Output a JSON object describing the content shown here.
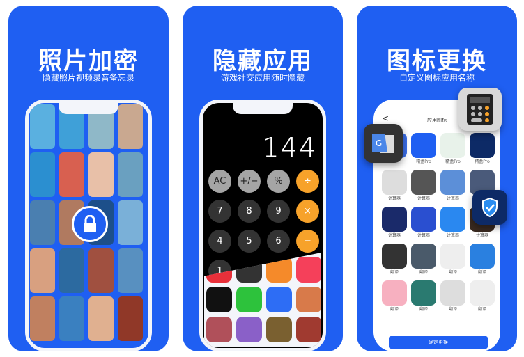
{
  "panels": [
    {
      "title": "照片加密",
      "subtitle": "隐藏照片视频录音备忘录"
    },
    {
      "title": "隐藏应用",
      "subtitle": "游戏社交应用随时隐藏"
    },
    {
      "title": "图标更换",
      "subtitle": "自定义图标应用名称"
    }
  ],
  "calculator": {
    "display": "144",
    "keys": [
      "AC",
      "+/−",
      "%",
      "÷",
      "7",
      "8",
      "9",
      "×",
      "4",
      "5",
      "6",
      "−",
      "1"
    ]
  },
  "icon_screen": {
    "header": "应用图标",
    "back": "<",
    "confirm": "确定更换",
    "labels": [
      "",
      "精盒Pro",
      "精盒Pro",
      "精盒Pro",
      "计算器",
      "计算器",
      "计算器",
      "计算器",
      "计算器",
      "计算器",
      "计算器",
      "计算器",
      "翻译",
      "翻译",
      "翻译",
      "翻译",
      "翻译",
      "翻译",
      "翻译",
      "翻译"
    ]
  },
  "brand_color": "#1f5ff2"
}
